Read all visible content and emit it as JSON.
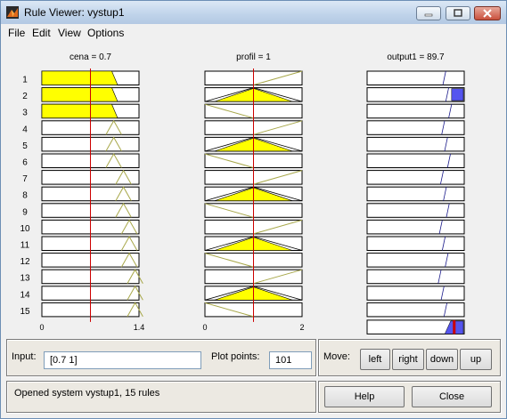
{
  "window": {
    "title": "Rule Viewer: vystup1"
  },
  "menu": {
    "items": [
      "File",
      "Edit",
      "View",
      "Options"
    ]
  },
  "plot": {
    "columns": [
      {
        "title": "cena = 0.7",
        "tick_min": "0",
        "tick_max": "1.4",
        "input_value": 0.7,
        "range": [
          0,
          1.4
        ]
      },
      {
        "title": "profil = 1",
        "tick_min": "0",
        "tick_max": "2",
        "input_value": 1,
        "range": [
          0,
          2
        ]
      },
      {
        "title": "output1 = 89.7",
        "tick_min": "0",
        "tick_max": "100",
        "output_value": 89.7,
        "range": [
          0,
          100
        ]
      }
    ],
    "rules": [
      "1",
      "2",
      "3",
      "4",
      "5",
      "6",
      "7",
      "8",
      "9",
      "10",
      "11",
      "12",
      "13",
      "14",
      "15"
    ],
    "colors": {
      "input_fill": "#ffff00",
      "output_fill": "#5555ee",
      "marker": "#cc0000",
      "mf_line": "#a8a84a",
      "output_line": "#1a1a8a"
    }
  },
  "input_panel": {
    "input_label": "Input:",
    "input_value": "[0.7 1]",
    "plot_points_label": "Plot points:",
    "plot_points_value": "101"
  },
  "move_panel": {
    "label": "Move:",
    "left": "left",
    "right": "right",
    "down": "down",
    "up": "up"
  },
  "status": {
    "text": "Opened system vystup1, 15 rules"
  },
  "actions": {
    "help": "Help",
    "close": "Close"
  }
}
